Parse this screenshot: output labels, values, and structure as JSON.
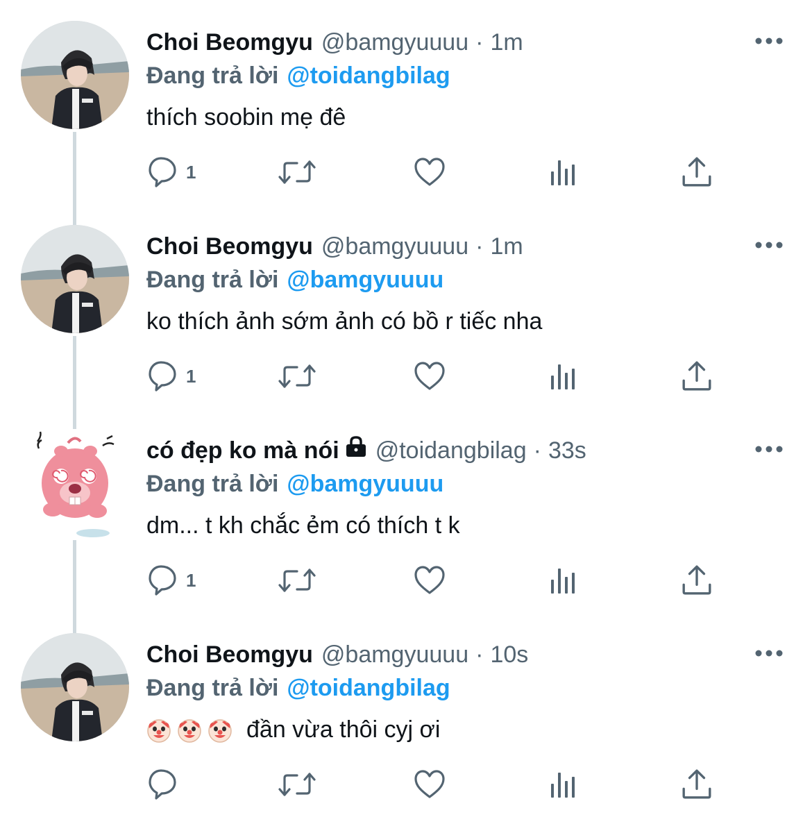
{
  "tweets": [
    {
      "author": {
        "name": "Choi Beomgyu",
        "handle": "@bamgyuuuu",
        "avatar_type": "person-photo",
        "locked": false
      },
      "separator": "·",
      "time": "1m",
      "reply_label": "Đang trả lời",
      "reply_to": "@toidangbilag",
      "text": "thích soobin mẹ đê",
      "emojis": [],
      "reply_count": "1"
    },
    {
      "author": {
        "name": "Choi Beomgyu",
        "handle": "@bamgyuuuu",
        "avatar_type": "person-photo",
        "locked": false
      },
      "separator": "·",
      "time": "1m",
      "reply_label": "Đang trả lời",
      "reply_to": "@bamgyuuuu",
      "text": "ko thích ảnh sớm ảnh có bồ r tiếc nha",
      "emojis": [],
      "reply_count": "1"
    },
    {
      "author": {
        "name": "có đẹp ko mà nói",
        "handle": "@toidangbilag",
        "avatar_type": "pink-beaver-sticker",
        "locked": true
      },
      "separator": "·",
      "time": "33s",
      "reply_label": "Đang trả lời",
      "reply_to": "@bamgyuuuu",
      "text": "dm... t kh chắc ẻm có thích t k",
      "emojis": [],
      "reply_count": "1"
    },
    {
      "author": {
        "name": "Choi Beomgyu",
        "handle": "@bamgyuuuu",
        "avatar_type": "person-photo",
        "locked": false
      },
      "separator": "·",
      "time": "10s",
      "reply_label": "Đang trả lời",
      "reply_to": "@toidangbilag",
      "text": "đần vừa thôi cyj ơi",
      "emojis": [
        "clown-face-icon",
        "clown-face-icon",
        "clown-face-icon"
      ],
      "reply_count": ""
    }
  ],
  "icons": {
    "more": "more-horizontal-icon",
    "reply": "comment-bubble-icon",
    "retweet": "retweet-icon",
    "like": "heart-icon",
    "views": "views-bar-chart-icon",
    "share": "share-upload-icon",
    "lock": "lock-icon"
  },
  "colors": {
    "text": "#0f1419",
    "secondary": "#536471",
    "mention": "#1d9bf0",
    "thread_line": "#cfd9de"
  }
}
